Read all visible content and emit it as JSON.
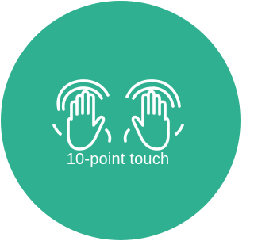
{
  "colors": {
    "background": "#ffffff",
    "badge": "#2fb091",
    "icon_stroke": "#ffffff"
  },
  "icon": "multi-touch-hands-icon",
  "caption": "10-point touch"
}
